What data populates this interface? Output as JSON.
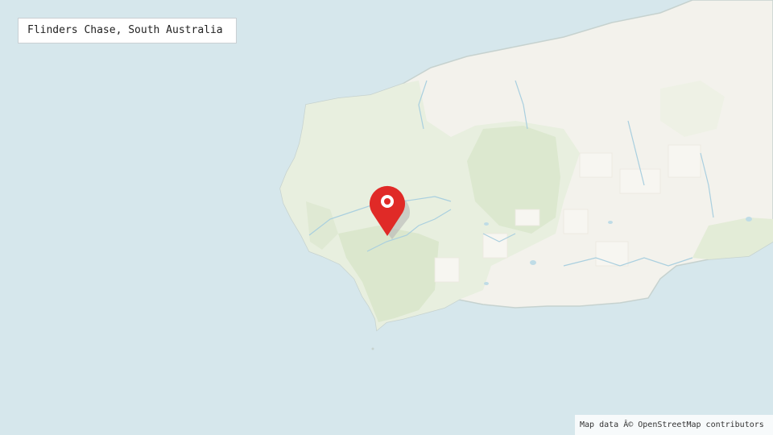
{
  "map": {
    "place_label": "Flinders Chase, South Australia",
    "attribution": {
      "prefix": "Map data ",
      "copyright": "Â©",
      "suffix": " OpenStreetMap contributors"
    },
    "marker_icon": "location-pin-icon",
    "colors": {
      "water": "#d6e7ec",
      "land": "#f3f2ec",
      "park": "#e6eedb",
      "park_dark": "#d9e6c9",
      "coast": "#b9c7c4",
      "river": "#a9cfdf",
      "marker": "#e02a27"
    }
  }
}
